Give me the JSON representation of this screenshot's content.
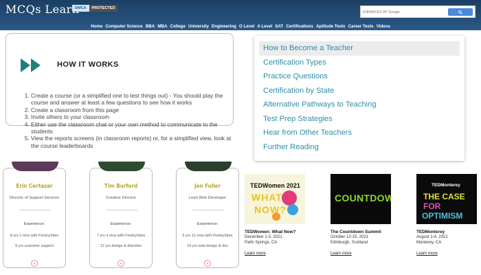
{
  "header": {
    "logo": "MCQs Learn",
    "badge_left": "DMCA",
    "badge_right": "PROTECTED",
    "search_placeholder": "ENHANCED BY Google",
    "nav": [
      "Home",
      "Computer Science",
      "BBA",
      "MBA",
      "College",
      "University",
      "Engineering",
      "O Level",
      "A Level",
      "SAT",
      "Certifications",
      "Aptitude Tests",
      "Career Tests",
      "Videos"
    ]
  },
  "how_it_works": {
    "title": "HOW IT WORKS",
    "steps": [
      "Create a course (or a simplified one to test things out) - You should play the course and answer at least a few questions to see how it works",
      "Create a classroom from this page",
      "Invite others to your classroom",
      "Either use the classroom chat or your own method to communicate to the students",
      "View the reports screens (in classroom reports) or, for a simplified view, look at the course leaderboards"
    ]
  },
  "teacher_menu": {
    "items": [
      "How to Become a Teacher",
      "Certification Types",
      "Practice Questions",
      "Certification by State",
      "Alternative Pathways to Teaching",
      "Test Prep Strategies",
      "Hear from Other Teachers",
      "Further Reading"
    ]
  },
  "team": [
    {
      "name": "Erin Cortazar",
      "role": "Director of Support Services",
      "exp_label": "Experience:",
      "line1": "8 yrs 1 mos with FreshySites",
      "line2": "9 yrs customer support"
    },
    {
      "name": "Tim Burford",
      "role": "Creative Director",
      "exp_label": "Experience:",
      "line1": "7 yrs 4 mos with FreshySites",
      "line2": "12 yrs design & direction"
    },
    {
      "name": "Jon Fuller",
      "role": "Lead Web Developer",
      "exp_label": "Experience:",
      "line1": "6 yrs 11 mos with FreshySites",
      "line2": "19 yrs web design & dev"
    }
  ],
  "events": [
    {
      "image_text": [
        "TEDWomen 2021",
        "WHAT",
        "NOW?"
      ],
      "title": "TEDWomen: What Now?",
      "dates": "December 1-3, 2021",
      "location": "Palm Springs, CA",
      "link": "Learn more"
    },
    {
      "image_text": [
        "COUNTDOWN"
      ],
      "title": "The Countdown Summit",
      "dates": "October 12-15, 2021",
      "location": "Edinburgh, Scotland",
      "link": "Learn more"
    },
    {
      "image_text": [
        "TEDMonterey",
        "THE CASE",
        "FOR",
        "OPTIMISM"
      ],
      "title": "TEDMonterey",
      "dates": "August 1-4, 2021",
      "location": "Monterey, CA",
      "link": "Learn more"
    }
  ],
  "colors": {
    "header_bg": "#1c3f63",
    "menu_link": "#2e8fa6",
    "icon_teal": "#1f7f7d",
    "name_gold": "#b4a71f",
    "countdown_green": "#8cd62a"
  }
}
